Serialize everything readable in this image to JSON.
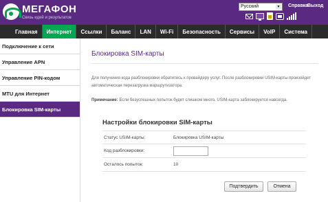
{
  "header": {
    "brand_name": "МЕГАФОН",
    "brand_slogan": "Связь идей и результатов",
    "language": "Русский",
    "links": {
      "help": "Справка",
      "logout": "Выход"
    },
    "accent_color": "#5a2a82",
    "brand_green": "#00a651",
    "status_icons": [
      "mail-icon",
      "computer-icon",
      "sim-icon",
      "network-icon",
      "signal-icon"
    ]
  },
  "nav": {
    "items": [
      "Главная",
      "Интернет",
      "Ссылки",
      "Баланс",
      "LAN",
      "Wi-Fi",
      "Безопасность",
      "Сервисы",
      "VoIP",
      "Система"
    ],
    "active": "Интернет"
  },
  "sidebar": {
    "items": [
      "Подключение к сети",
      "Управление APN",
      "Управление PIN-кодом",
      "MTU для Интернет",
      "Блокировка SIM-карты"
    ],
    "active": "Блокировка SIM-карты"
  },
  "main": {
    "title": "Блокировка SIM-карты",
    "description": "Для получения кода разблокировки обратитесь к провайдеру услуг. После разблокировки USIM-карты произойдет автоматическая перезагрузка маршрутизатора.",
    "note_label": "Примечание:",
    "note_text": "Если безуспешных попыток будет слишком много, USIM-карта заблокируется навсегда.",
    "section_title": "Настройки блокировки SIM-карты",
    "status_label": "Статус USIM-карты:",
    "status_value": "Блокировка USIM-карты",
    "code_label": "Код разблокировки:",
    "code_value": "",
    "attempts_label": "Осталось попыток:",
    "attempts_value": "10",
    "confirm_button": "Подтвердить",
    "cancel_button": "Отмена"
  }
}
